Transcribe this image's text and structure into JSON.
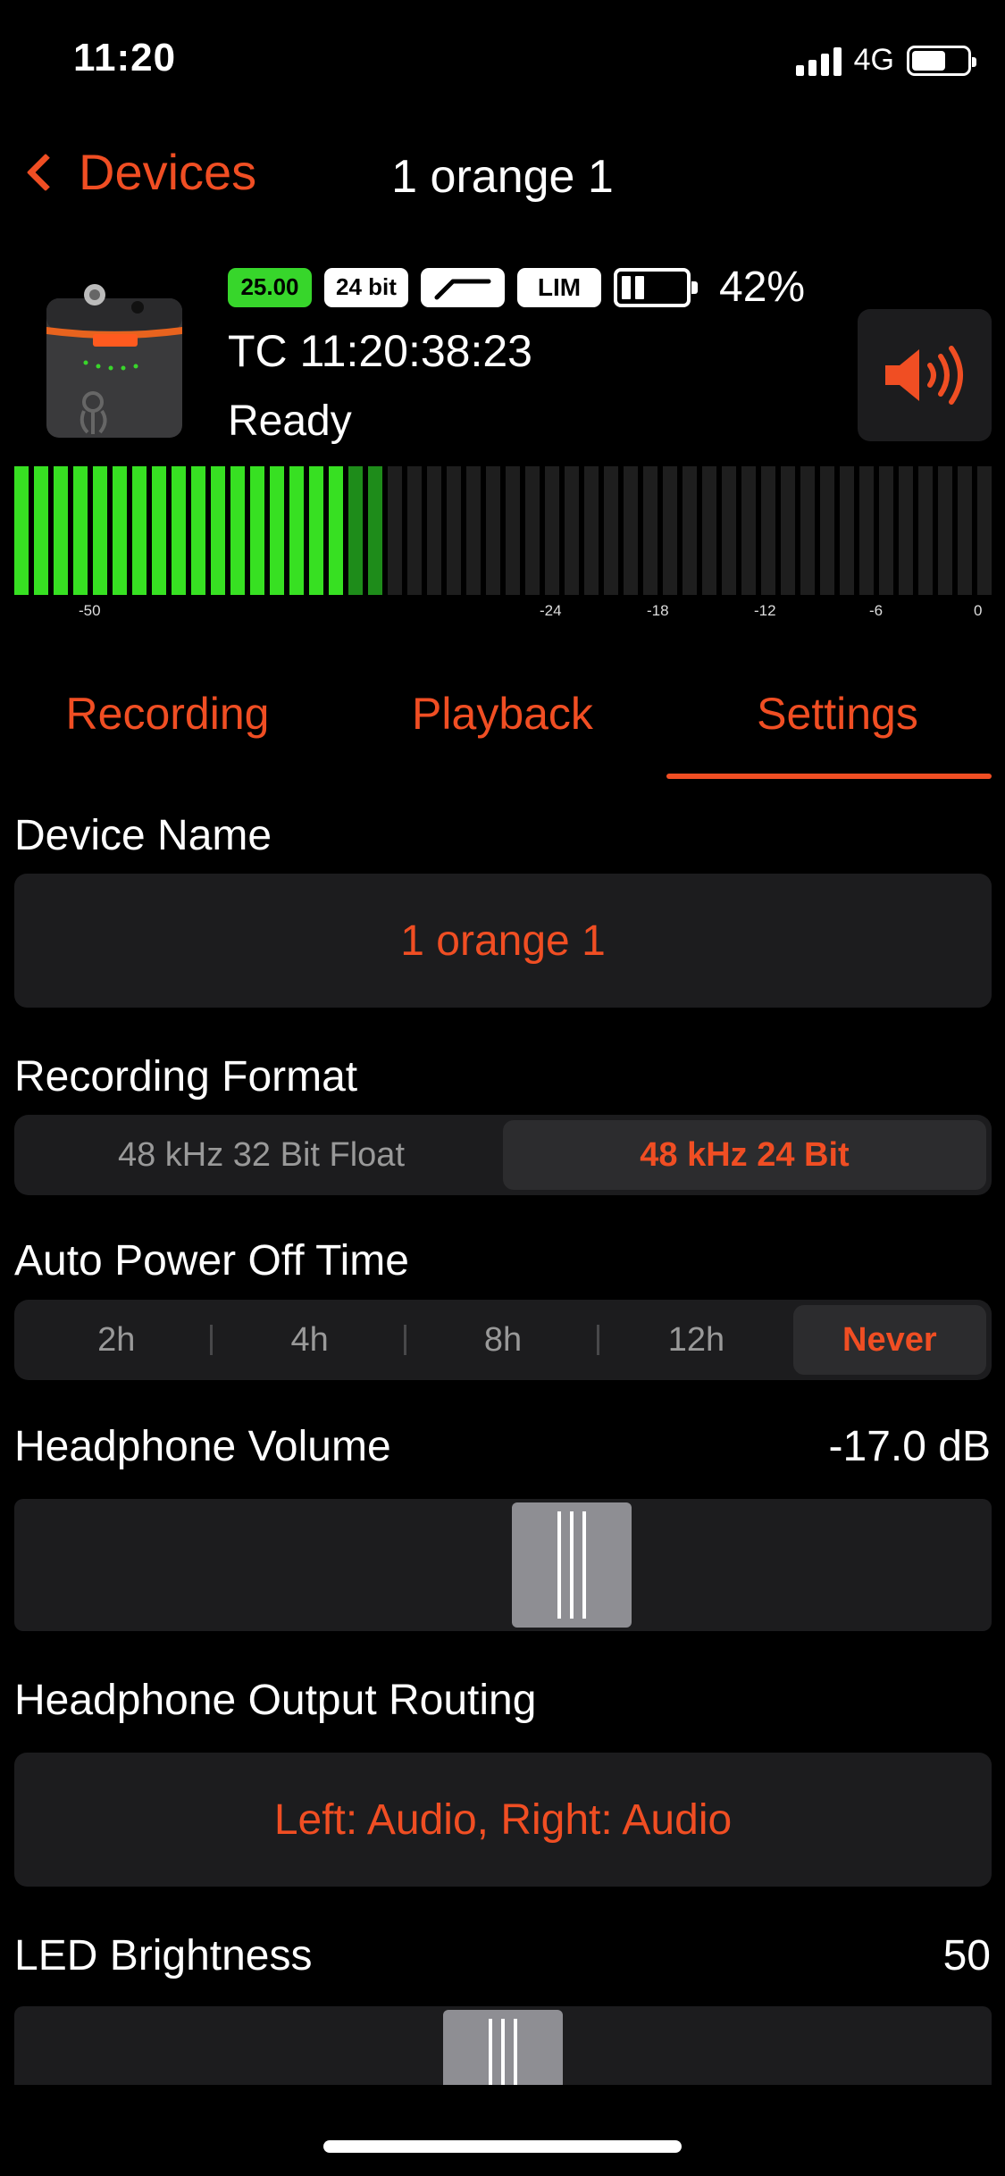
{
  "status": {
    "time": "11:20",
    "network": "4G"
  },
  "nav": {
    "back_label": "Devices",
    "title": "1 orange 1"
  },
  "device": {
    "badges": {
      "fps": "25.00",
      "bit": "24 bit",
      "limiter": "LIM"
    },
    "battery_pct": "42%",
    "timecode": "TC 11:20:38:23",
    "state": "Ready"
  },
  "meter": {
    "scale": [
      "-50",
      "-24",
      "-18",
      "-12",
      "-6",
      "0"
    ],
    "total_bars": 50,
    "lit_bars": 17,
    "dim_bars": 2
  },
  "tabs": [
    "Recording",
    "Playback",
    "Settings"
  ],
  "selected_tab": "Settings",
  "settings": {
    "device_name_label": "Device Name",
    "device_name_value": "1 orange 1",
    "format_label": "Recording Format",
    "format_options": [
      "48 kHz 32 Bit Float",
      "48 kHz 24 Bit"
    ],
    "format_selected": "48 kHz 24 Bit",
    "power_label": "Auto Power Off Time",
    "power_options": [
      "2h",
      "4h",
      "8h",
      "12h",
      "Never"
    ],
    "power_selected": "Never",
    "hp_volume_label": "Headphone Volume",
    "hp_volume_value": "-17.0 dB",
    "hp_volume_fraction": 0.58,
    "routing_label": "Headphone Output Routing",
    "routing_value": "Left: Audio, Right: Audio",
    "led_label": "LED Brightness",
    "led_value": "50",
    "led_fraction": 0.5
  },
  "colors": {
    "accent": "#f04e23",
    "meter_green": "#37e022",
    "panel": "#1c1c1e"
  }
}
